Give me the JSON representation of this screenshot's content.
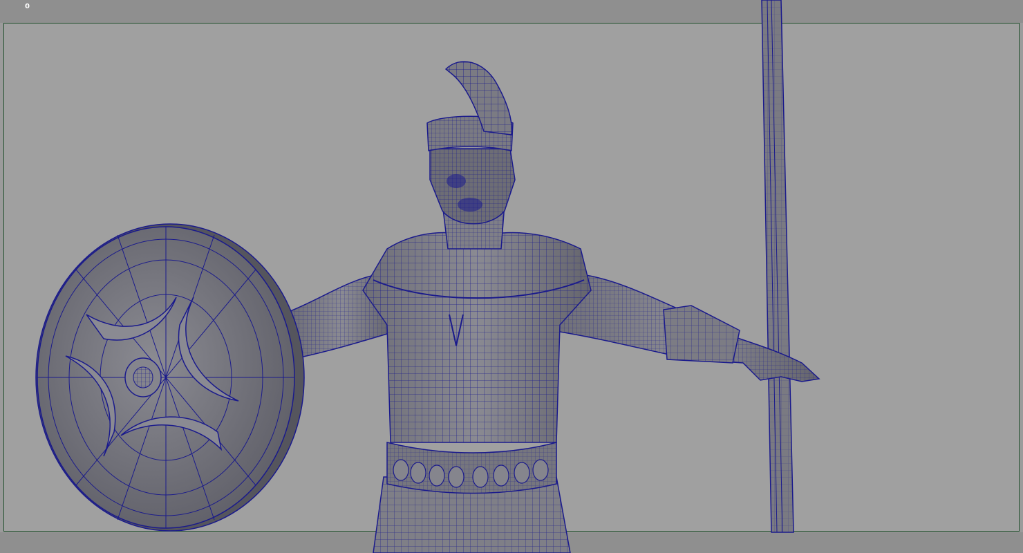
{
  "viewport": {
    "frame_counter": "0",
    "background_color": "#a0a0a0",
    "wireframe_color": "#1a1a8c",
    "mesh_fill_color": "#7d7d85",
    "gate_border_color": "#1e4f2b"
  },
  "scene": {
    "subject": "roman-soldier-wireframe",
    "objects": [
      "helmet",
      "head",
      "torso",
      "left-arm",
      "right-arm",
      "belt",
      "skirt",
      "shield",
      "spear"
    ]
  }
}
